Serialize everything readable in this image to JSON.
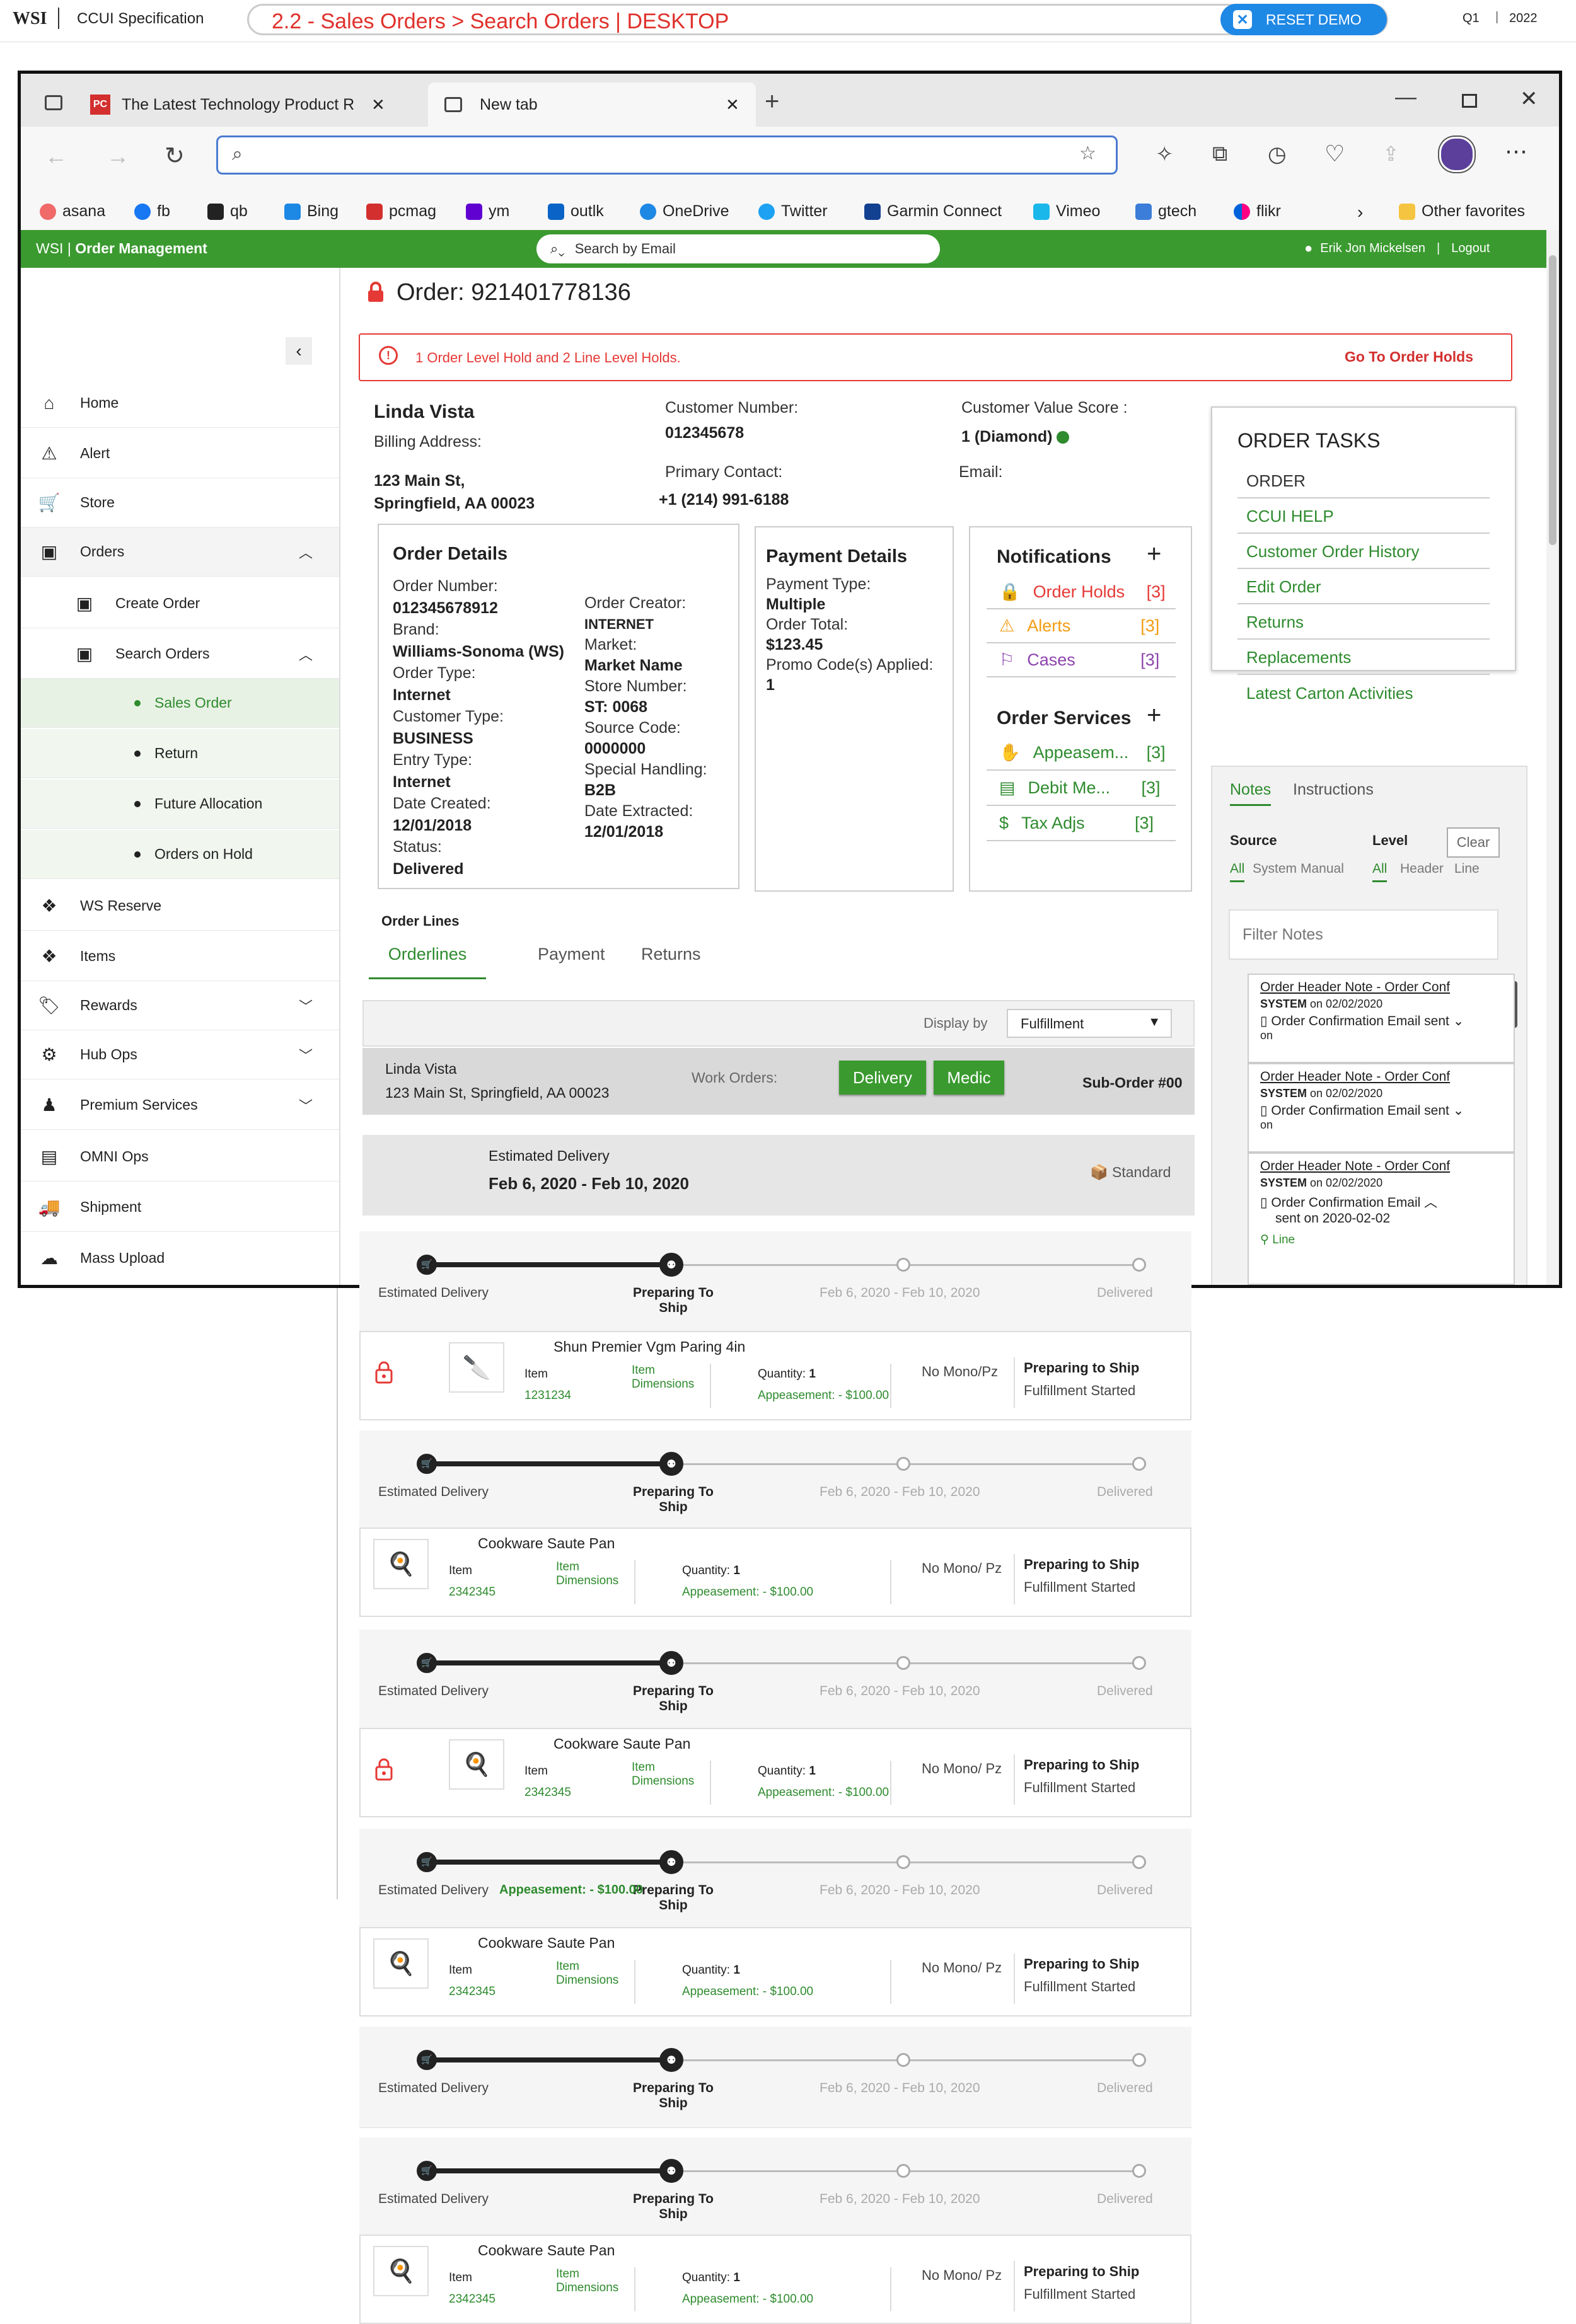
{
  "spec": {
    "brand": "WSI",
    "product": "CCUI Specification",
    "breadcrumb": "2.2 - Sales Orders > Search Orders | DESKTOP",
    "reset": "RESET DEMO",
    "quarter": "Q1",
    "year": "2022"
  },
  "browser": {
    "tabs": [
      {
        "title": "The Latest Technology Product R"
      },
      {
        "title": "New tab"
      }
    ],
    "address_value": "",
    "bookmarks": [
      "asana",
      "fb",
      "qb",
      "Bing",
      "pcmag",
      "ym",
      "outlk",
      "OneDrive",
      "Twitter",
      "Garmin Connect",
      "Vimeo",
      "gtech",
      "flikr"
    ],
    "other_favorites": "Other favorites"
  },
  "app": {
    "brand": "WSI",
    "title": "Order Management",
    "search_placeholder": "Search by Email",
    "user": "Erik Jon Mickelsen",
    "logout": "Logout"
  },
  "sidebar": {
    "items": [
      {
        "label": "Home",
        "icon": "home-icon"
      },
      {
        "label": "Alert",
        "icon": "alert-icon"
      },
      {
        "label": "Store",
        "icon": "cart-icon"
      },
      {
        "label": "Orders",
        "icon": "box-icon"
      },
      {
        "label": "Create Order",
        "icon": "box-plus-icon"
      },
      {
        "label": "Search Orders",
        "icon": "box-search-icon"
      },
      {
        "label": "Sales Order"
      },
      {
        "label": "Return"
      },
      {
        "label": "Future Allocation"
      },
      {
        "label": "Orders on Hold"
      },
      {
        "label": "WS Reserve",
        "icon": "reserve-icon"
      },
      {
        "label": "Items",
        "icon": "items-icon"
      },
      {
        "label": "Rewards",
        "icon": "tag-icon"
      },
      {
        "label": "Hub Ops",
        "icon": "hub-icon"
      },
      {
        "label": "Premium Services",
        "icon": "person-icon"
      },
      {
        "label": "OMNI Ops",
        "icon": "omni-icon"
      },
      {
        "label": "Shipment",
        "icon": "truck-icon"
      },
      {
        "label": "Mass Upload",
        "icon": "upload-icon"
      }
    ]
  },
  "order": {
    "title": "Order: 921401778136",
    "hold_banner": "1 Order Level Hold and 2 Line Level Holds.",
    "hold_link": "Go To Order Holds",
    "customer_name": "Linda Vista",
    "billing_label": "Billing Address:",
    "address1": "123 Main St,",
    "address2": "Springfield, AA 00023",
    "customer_number_label": "Customer Number:",
    "customer_number": "012345678",
    "primary_contact_label": "Primary Contact:",
    "primary_contact": "+1 (214) 991-6188",
    "cvs_label": "Customer Value Score  :",
    "cvs": "1 (Diamond)",
    "email_label": "Email:"
  },
  "details": {
    "title": "Order Details",
    "left": [
      {
        "label": "Order Number:",
        "value": "012345678912"
      },
      {
        "label": "Brand:",
        "value": "Williams-Sonoma (WS)"
      },
      {
        "label": "Order Type:",
        "value": "Internet"
      },
      {
        "label": "Customer Type:",
        "value": "BUSINESS"
      },
      {
        "label": "Entry Type:",
        "value": "Internet"
      },
      {
        "label": "Date Created:",
        "value": "12/01/2018"
      },
      {
        "label": "Status:",
        "value": "Delivered"
      }
    ],
    "right": [
      {
        "label": "Order Creator:",
        "value": "INTERNET"
      },
      {
        "label": "Market:",
        "value": "Market Name"
      },
      {
        "label": "Store Number:",
        "value": "ST: 0068"
      },
      {
        "label": "Source Code:",
        "value": "0000000"
      },
      {
        "label": "Special Handling:",
        "value": "B2B"
      },
      {
        "label": "Date Extracted:",
        "value": "12/01/2018"
      }
    ]
  },
  "payment": {
    "title": "Payment Details",
    "type_label": "Payment Type:",
    "type": "Multiple",
    "total_label": "Order Total:",
    "total": "$123.45",
    "promo_label": "Promo Code(s) Applied:",
    "promo": "1"
  },
  "notifications": {
    "title": "Notifications",
    "items": [
      {
        "label": "Order Holds",
        "count": "[3]"
      },
      {
        "label": "Alerts",
        "count": "[3]"
      },
      {
        "label": "Cases",
        "count": "[3]"
      }
    ],
    "services_title": "Order Services",
    "services": [
      {
        "label": "Appeasem...",
        "count": "[3]"
      },
      {
        "label": "Debit Me...",
        "count": "[3]"
      },
      {
        "label": "Tax Adjs",
        "count": "[3]"
      }
    ]
  },
  "tasks": {
    "title": "ORDER TASKS",
    "header": "ORDER",
    "items": [
      "CCUI HELP",
      "Customer Order History",
      "Edit Order",
      "Returns",
      "Replacements",
      "Latest Carton Activities"
    ]
  },
  "notes": {
    "tabs": [
      "Notes",
      "Instructions"
    ],
    "source_label": "Source",
    "level_label": "Level",
    "clear": "Clear",
    "source_opts": [
      "All",
      "System",
      "Manual"
    ],
    "level_opts": [
      "All",
      "Header",
      "Line"
    ],
    "filter_placeholder": "Filter Notes",
    "entries": [
      {
        "title": "Order Header Note - Order Conf",
        "author": "SYSTEM",
        "date": "on 02/02/2020",
        "text": "Order Confirmation Email sent",
        "more": "on"
      },
      {
        "title": "Order Header Note - Order Conf",
        "author": "SYSTEM",
        "date": "on 02/02/2020",
        "text": "Order Confirmation Email sent",
        "more": "on"
      },
      {
        "title": "Order Header Note - Order Conf",
        "author": "SYSTEM",
        "date": "on 02/02/2020",
        "text": "Order Confirmation Email",
        "more": "sent on 2020-02-02",
        "tag": "Line"
      }
    ]
  },
  "lines": {
    "title": "Order Lines",
    "tabs": [
      "Orderlines",
      "Payment",
      "Returns"
    ],
    "display_by_label": "Display by",
    "display_by": "Fulfillment",
    "ship_name": "Linda Vista",
    "ship_address": "123 Main St, Springfield, AA 00023",
    "work_orders_label": "Work Orders:",
    "wo_buttons": [
      "Delivery",
      "Medic"
    ],
    "suborder": "Sub-Order #00",
    "est_label": "Estimated Delivery",
    "est_range": "Feb 6, 2020 - Feb 10, 2020",
    "shipping": "Standard",
    "progress_labels": [
      "Estimated Delivery",
      "Preparing To Ship",
      "Feb 6, 2020 - Feb 10, 2020",
      "Delivered"
    ],
    "appeasement_overlay": "Appeasement: - $100.00",
    "items": [
      {
        "name": "Shun Premier Vgm Paring 4in",
        "item_label": "Item",
        "item_no": "1231234",
        "dim_label": "Item Dimensions",
        "qty_label": "Quantity:",
        "qty": "1",
        "appeasement": "Appeasement: - $100.00",
        "mono": "No Mono/Pz",
        "status1": "Preparing to Ship",
        "status2": "Fulfillment Started",
        "locked": true
      },
      {
        "name": "Cookware Saute Pan",
        "item_label": "Item",
        "item_no": "2342345",
        "dim_label": "Item Dimensions",
        "qty_label": "Quantity:",
        "qty": "1",
        "appeasement": "Appeasement: - $100.00",
        "mono": "No Mono/ Pz",
        "status1": "Preparing to Ship",
        "status2": "Fulfillment Started",
        "locked": false
      },
      {
        "name": "Cookware Saute Pan",
        "item_label": "Item",
        "item_no": "2342345",
        "dim_label": "Item Dimensions",
        "qty_label": "Quantity:",
        "qty": "1",
        "appeasement": "Appeasement: - $100.00",
        "mono": "No Mono/ Pz",
        "status1": "Preparing to Ship",
        "status2": "Fulfillment Started",
        "locked": true
      },
      {
        "name": "Cookware Saute Pan",
        "item_label": "Item",
        "item_no": "2342345",
        "dim_label": "Item Dimensions",
        "qty_label": "Quantity:",
        "qty": "1",
        "appeasement": "Appeasement: - $100.00",
        "mono": "No Mono/ Pz",
        "status1": "Preparing to Ship",
        "status2": "Fulfillment Started",
        "locked": false
      },
      {
        "name": "Cookware Saute Pan",
        "item_label": "Item",
        "item_no": "2342345",
        "dim_label": "Item Dimensions",
        "qty_label": "Quantity:",
        "qty": "1",
        "appeasement": "Appeasement: - $100.00",
        "mono": "No Mono/ Pz",
        "status1": "Preparing to Ship",
        "status2": "Fulfillment Started",
        "locked": false
      }
    ]
  }
}
